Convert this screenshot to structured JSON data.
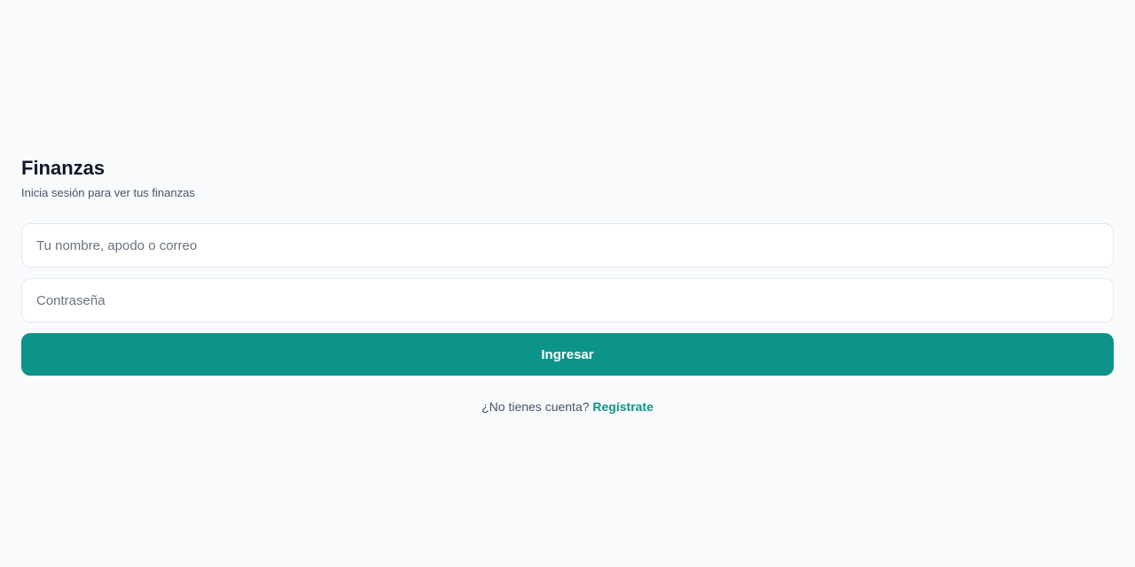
{
  "app": {
    "title": "Finanzas",
    "subtitle": "Inicia sesión para ver tus finanzas"
  },
  "form": {
    "username": {
      "value": "",
      "placeholder": "Tu nombre, apodo o correo"
    },
    "password": {
      "value": "",
      "placeholder": "Contraseña"
    },
    "submit_label": "Ingresar"
  },
  "register": {
    "prompt": "¿No tienes cuenta?",
    "link_label": "Regístrate"
  },
  "colors": {
    "background": "#f8fafc",
    "accent": "#0d9488",
    "title": "#0f172a",
    "muted_text": "#475569",
    "field_border": "#e2e8f0"
  }
}
